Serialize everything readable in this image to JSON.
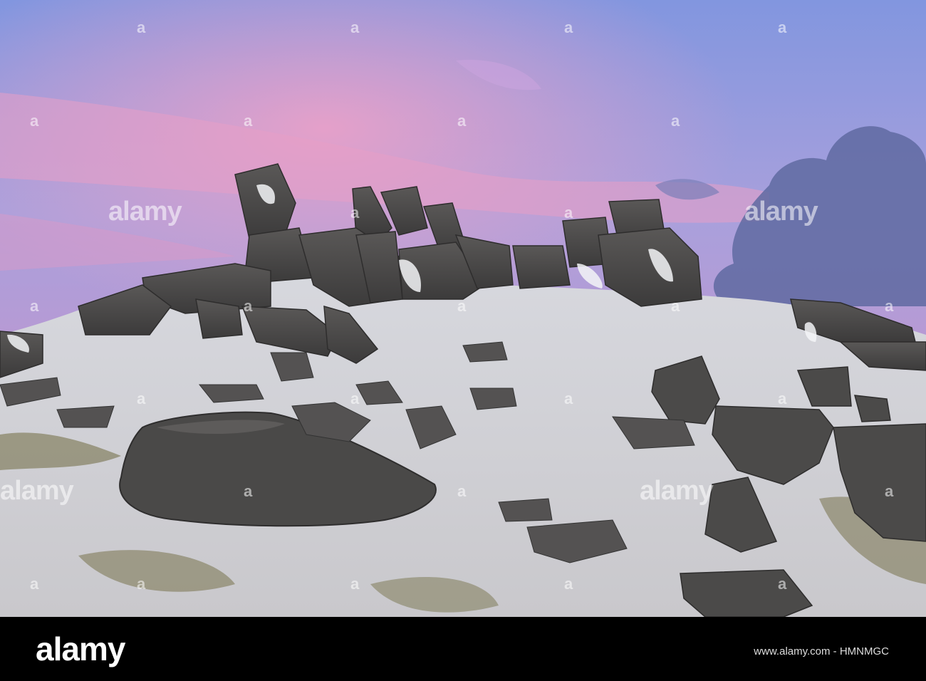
{
  "photo": {
    "subject": "snow-covered-granite-tor-at-dusk",
    "sky_colors": [
      "#8ba3e0",
      "#b79bd9",
      "#e39bc4",
      "#a3b1e6"
    ],
    "rock_color": "#4a4848",
    "snow_color": "#f1f2f4",
    "grass_color": "#6f6a3f"
  },
  "watermark": {
    "brand_text": "alamy",
    "dot_glyph": "a"
  },
  "footer": {
    "brand_text": "alamy",
    "image_id_text": "www.alamy.com - HMNMGC"
  }
}
